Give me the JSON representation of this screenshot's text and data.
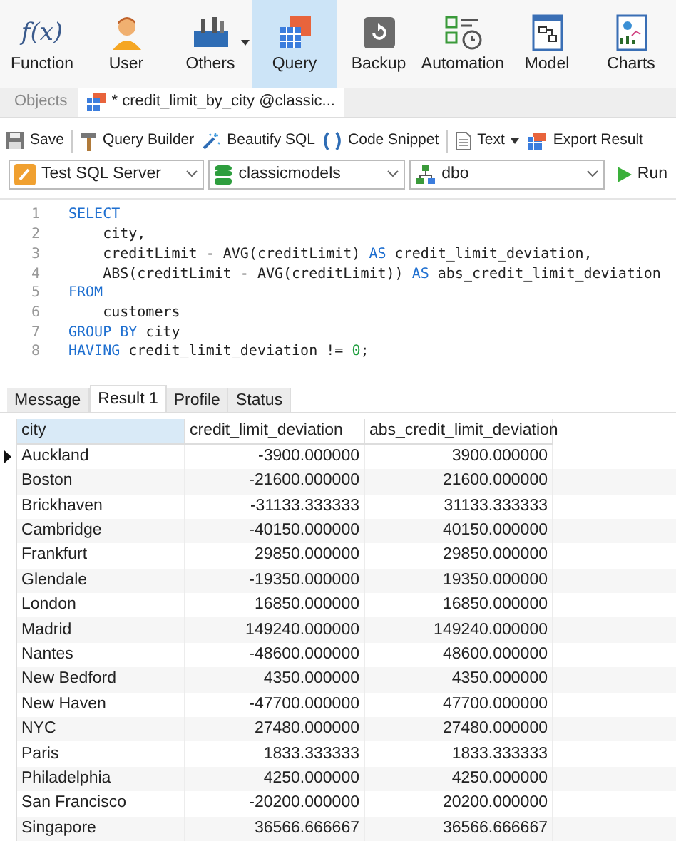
{
  "ribbon": [
    {
      "label": "Function",
      "kind": "function",
      "glyph": "f(x)",
      "selected": false
    },
    {
      "label": "User",
      "kind": "user",
      "selected": false
    },
    {
      "label": "Others",
      "kind": "others",
      "selected": false
    },
    {
      "label": "Query",
      "kind": "query",
      "selected": true
    },
    {
      "label": "Backup",
      "kind": "backup",
      "selected": false
    },
    {
      "label": "Automation",
      "kind": "automation",
      "selected": false
    },
    {
      "label": "Model",
      "kind": "model",
      "selected": false
    },
    {
      "label": "Charts",
      "kind": "charts",
      "selected": false
    }
  ],
  "doc_tabs": [
    {
      "label": "Objects",
      "selected": false
    },
    {
      "label": "* credit_limit_by_city @classic...",
      "selected": true
    }
  ],
  "toolbar": [
    {
      "label": "Save",
      "kind": "save"
    },
    {
      "label": "Query Builder",
      "kind": "builder"
    },
    {
      "label": "Beautify SQL",
      "kind": "beautify"
    },
    {
      "label": "Code Snippet",
      "kind": "snippet"
    },
    {
      "label": "Text",
      "kind": "text"
    },
    {
      "label": "Export Result",
      "kind": "export"
    }
  ],
  "selectors": [
    {
      "value": "Test SQL Server",
      "kind": "server"
    },
    {
      "value": "classicmodels",
      "kind": "database"
    },
    {
      "value": "dbo",
      "kind": "schema"
    }
  ],
  "run_label": "Run",
  "code": [
    {
      "number": "1",
      "tokens": [
        {
          "t": "SELECT",
          "kind": "keyword"
        }
      ]
    },
    {
      "number": "2",
      "tokens": [
        {
          "t": "    city,",
          "kind": "plain"
        }
      ]
    },
    {
      "number": "3",
      "tokens": [
        {
          "t": "    creditLimit - AVG(creditLimit) ",
          "kind": "plain"
        },
        {
          "t": "AS",
          "kind": "keyword"
        },
        {
          "t": " credit_limit_deviation,",
          "kind": "plain"
        }
      ]
    },
    {
      "number": "4",
      "tokens": [
        {
          "t": "    ABS(creditLimit - AVG(creditLimit)) ",
          "kind": "plain"
        },
        {
          "t": "AS",
          "kind": "keyword"
        },
        {
          "t": " abs_credit_limit_deviation",
          "kind": "plain"
        }
      ]
    },
    {
      "number": "5",
      "tokens": [
        {
          "t": "FROM",
          "kind": "keyword"
        }
      ]
    },
    {
      "number": "6",
      "tokens": [
        {
          "t": "    customers",
          "kind": "plain"
        }
      ]
    },
    {
      "number": "7",
      "tokens": [
        {
          "t": "GROUP BY",
          "kind": "keyword"
        },
        {
          "t": " city",
          "kind": "plain"
        }
      ]
    },
    {
      "number": "8",
      "tokens": [
        {
          "t": "HAVING",
          "kind": "keyword"
        },
        {
          "t": " credit_limit_deviation != ",
          "kind": "plain"
        },
        {
          "t": "0",
          "kind": "number"
        },
        {
          "t": ";",
          "kind": "plain"
        }
      ]
    }
  ],
  "result_tabs": [
    {
      "label": "Message",
      "selected": false
    },
    {
      "label": "Result 1",
      "selected": true
    },
    {
      "label": "Profile",
      "selected": false
    },
    {
      "label": "Status",
      "selected": false
    }
  ],
  "table": {
    "columns": [
      "city",
      "credit_limit_deviation",
      "abs_credit_limit_deviation"
    ],
    "rows": [
      {
        "cells": [
          "Auckland",
          "-3900.000000",
          "3900.000000"
        ],
        "selected": true
      },
      {
        "cells": [
          "Boston",
          "-21600.000000",
          "21600.000000"
        ],
        "selected": false
      },
      {
        "cells": [
          "Brickhaven",
          "-31133.333333",
          "31133.333333"
        ],
        "selected": false
      },
      {
        "cells": [
          "Cambridge",
          "-40150.000000",
          "40150.000000"
        ],
        "selected": false
      },
      {
        "cells": [
          "Frankfurt",
          "29850.000000",
          "29850.000000"
        ],
        "selected": false
      },
      {
        "cells": [
          "Glendale",
          "-19350.000000",
          "19350.000000"
        ],
        "selected": false
      },
      {
        "cells": [
          "London",
          "16850.000000",
          "16850.000000"
        ],
        "selected": false
      },
      {
        "cells": [
          "Madrid",
          "149240.000000",
          "149240.000000"
        ],
        "selected": false
      },
      {
        "cells": [
          "Nantes",
          "-48600.000000",
          "48600.000000"
        ],
        "selected": false
      },
      {
        "cells": [
          "New Bedford",
          "4350.000000",
          "4350.000000"
        ],
        "selected": false
      },
      {
        "cells": [
          "New Haven",
          "-47700.000000",
          "47700.000000"
        ],
        "selected": false
      },
      {
        "cells": [
          "NYC",
          "27480.000000",
          "27480.000000"
        ],
        "selected": false
      },
      {
        "cells": [
          "Paris",
          "1833.333333",
          "1833.333333"
        ],
        "selected": false
      },
      {
        "cells": [
          "Philadelphia",
          "4250.000000",
          "4250.000000"
        ],
        "selected": false
      },
      {
        "cells": [
          "San Francisco",
          "-20200.000000",
          "20200.000000"
        ],
        "selected": false
      },
      {
        "cells": [
          "Singapore",
          "36566.666667",
          "36566.666667"
        ],
        "selected": false
      }
    ]
  }
}
